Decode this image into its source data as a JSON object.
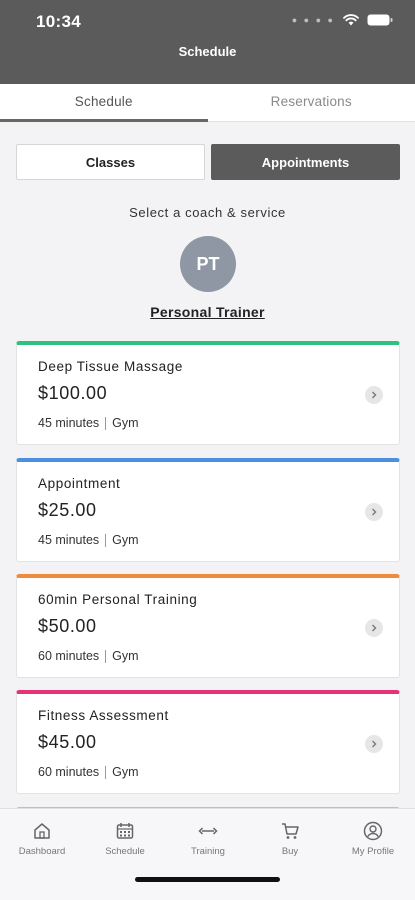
{
  "status_bar": {
    "time": "10:34"
  },
  "header": {
    "title": "Schedule"
  },
  "tabs": [
    {
      "label": "Schedule",
      "active": true
    },
    {
      "label": "Reservations",
      "active": false
    }
  ],
  "segment": {
    "classes_label": "Classes",
    "appointments_label": "Appointments",
    "selected": "Appointments"
  },
  "coach": {
    "prompt": "Select a coach & service",
    "initials": "PT",
    "name": "Personal Trainer"
  },
  "services": [
    {
      "name": "Deep Tissue Massage",
      "price": "$100.00",
      "duration": "45 minutes",
      "location": "Gym",
      "accent": "#2ec27e"
    },
    {
      "name": "Appointment",
      "price": "$25.00",
      "duration": "45 minutes",
      "location": "Gym",
      "accent": "#4a8fe2"
    },
    {
      "name": "60min Personal Training",
      "price": "$50.00",
      "duration": "60 minutes",
      "location": "Gym",
      "accent": "#f08a3c"
    },
    {
      "name": "Fitness Assessment",
      "price": "$45.00",
      "duration": "60 minutes",
      "location": "Gym",
      "accent": "#e5337a"
    }
  ],
  "bottom_nav": [
    {
      "label": "Dashboard",
      "icon": "home-icon"
    },
    {
      "label": "Schedule",
      "icon": "calendar-icon"
    },
    {
      "label": "Training",
      "icon": "dumbbell-icon"
    },
    {
      "label": "Buy",
      "icon": "cart-icon"
    },
    {
      "label": "My Profile",
      "icon": "profile-icon"
    }
  ]
}
